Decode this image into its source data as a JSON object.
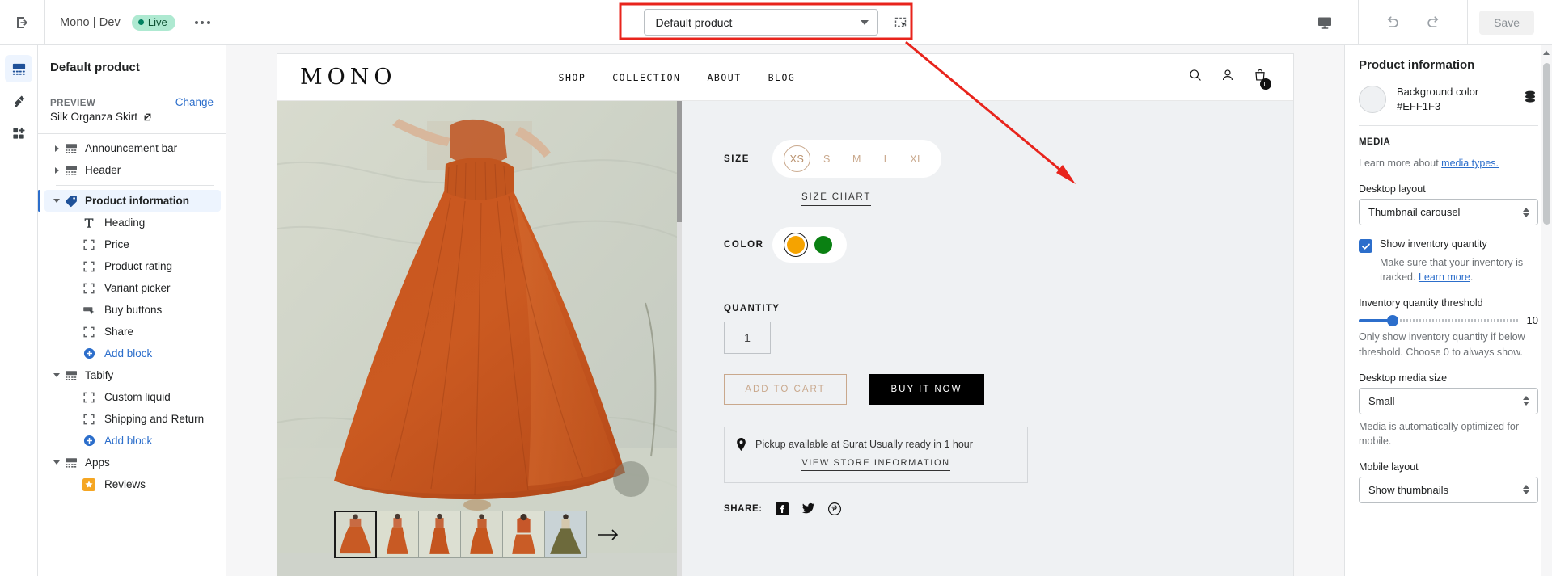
{
  "topbar": {
    "exit_icon": "exit-icon",
    "shop_name": "Mono | Dev",
    "live_label": "Live",
    "more_icon": "kebab-menu-icon",
    "product_selector_value": "Default product",
    "inspector_icon": "select-region-icon",
    "desktop_preview_icon": "desktop-icon",
    "undo_icon": "undo-icon",
    "redo_icon": "redo-icon",
    "save_label": "Save"
  },
  "rail": {
    "items": [
      {
        "name": "sections-icon",
        "active": true
      },
      {
        "name": "theme-settings-icon",
        "active": false
      },
      {
        "name": "apps-icon",
        "active": false
      }
    ]
  },
  "sidebar": {
    "title": "Default product",
    "preview_label": "PREVIEW",
    "change_label": "Change",
    "preview_value": "Silk Organza Skirt",
    "external_link_icon": "external-link-icon",
    "tree": [
      {
        "label": "Announcement bar",
        "level": 0,
        "icon": "section-icon",
        "arrow": "right",
        "selected": false
      },
      {
        "label": "Header",
        "level": 0,
        "icon": "section-icon",
        "arrow": "right",
        "selected": false
      },
      {
        "label": "Product information",
        "level": 0,
        "icon": "tag-icon",
        "arrow": "down",
        "selected": true
      },
      {
        "label": "Heading",
        "level": 1,
        "icon": "text-icon",
        "arrow": "none",
        "selected": false
      },
      {
        "label": "Price",
        "level": 1,
        "icon": "block-icon",
        "arrow": "none",
        "selected": false
      },
      {
        "label": "Product rating",
        "level": 1,
        "icon": "block-icon",
        "arrow": "none",
        "selected": false
      },
      {
        "label": "Variant picker",
        "level": 1,
        "icon": "block-icon",
        "arrow": "none",
        "selected": false
      },
      {
        "label": "Buy buttons",
        "level": 1,
        "icon": "buy-button-icon",
        "arrow": "none",
        "selected": false
      },
      {
        "label": "Share",
        "level": 1,
        "icon": "block-icon",
        "arrow": "none",
        "selected": false
      },
      {
        "label": "Add block",
        "level": 1,
        "icon": "plus-circle-icon",
        "arrow": "none",
        "selected": false,
        "link": true
      },
      {
        "label": "Tabify",
        "level": 0,
        "icon": "section-icon",
        "arrow": "down",
        "selected": false
      },
      {
        "label": "Custom liquid",
        "level": 1,
        "icon": "block-icon",
        "arrow": "none",
        "selected": false
      },
      {
        "label": "Shipping and Return",
        "level": 1,
        "icon": "block-icon",
        "arrow": "none",
        "selected": false
      },
      {
        "label": "Add block",
        "level": 1,
        "icon": "plus-circle-icon",
        "arrow": "none",
        "selected": false,
        "link": true
      },
      {
        "label": "Apps",
        "level": 0,
        "icon": "section-icon",
        "arrow": "down",
        "selected": false
      },
      {
        "label": "Reviews",
        "level": 1,
        "icon": "reviews-app-icon",
        "arrow": "none",
        "selected": false
      }
    ]
  },
  "preview": {
    "store": {
      "logo": "MONO",
      "nav": [
        "SHOP",
        "COLLECTION",
        "ABOUT",
        "BLOG"
      ],
      "search_icon": "search-icon",
      "account_icon": "account-icon",
      "cart_icon": "cart-icon",
      "cart_count": "0"
    },
    "product": {
      "size_label": "SIZE",
      "sizes": [
        "XS",
        "S",
        "M",
        "L",
        "XL"
      ],
      "selected_size": "XS",
      "size_chart_label": "SIZE CHART",
      "color_label": "COLOR",
      "colors": [
        {
          "name": "orange",
          "hex": "#F5A300",
          "selected": true
        },
        {
          "name": "green",
          "hex": "#0A8012",
          "selected": false
        }
      ],
      "quantity_label": "QUANTITY",
      "quantity_value": "1",
      "add_to_cart_label": "ADD TO CART",
      "buy_it_now_label": "BUY IT NOW",
      "pickup_icon": "map-pin-icon",
      "pickup_text": "Pickup available at Surat Usually ready in 1 hour",
      "view_store_label": "VIEW STORE INFORMATION",
      "share_label": "SHARE:",
      "share_icons": [
        "facebook-icon",
        "twitter-icon",
        "pinterest-icon"
      ],
      "thumbnail_count": 6,
      "active_thumbnail_index": 0,
      "next_arrow_icon": "arrow-right-icon"
    }
  },
  "inspector": {
    "title": "Product information",
    "background_color_label": "Background color",
    "background_color_hex": "#EFF1F3",
    "color_swatch_hex": "#EFF1F3",
    "layers_icon": "color-scheme-icon",
    "media_label": "MEDIA",
    "media_help_prefix": "Learn more about ",
    "media_help_link": "media types.",
    "desktop_layout_label": "Desktop layout",
    "desktop_layout_value": "Thumbnail carousel",
    "show_inventory_label": "Show inventory quantity",
    "show_inventory_checked": true,
    "show_inventory_help": "Make sure that your inventory is tracked. ",
    "show_inventory_help_link": "Learn more",
    "show_inventory_help_suffix": ".",
    "threshold_label": "Inventory quantity threshold",
    "threshold_value": "10",
    "threshold_help": "Only show inventory quantity if below threshold. Choose 0 to always show.",
    "desktop_media_size_label": "Desktop media size",
    "desktop_media_size_value": "Small",
    "media_optimized_help": "Media is automatically optimized for mobile.",
    "mobile_layout_label": "Mobile layout",
    "mobile_layout_value": "Show thumbnails"
  },
  "annotation": {
    "highlight_color": "#E8241C",
    "arrow_color": "#E8241C"
  }
}
